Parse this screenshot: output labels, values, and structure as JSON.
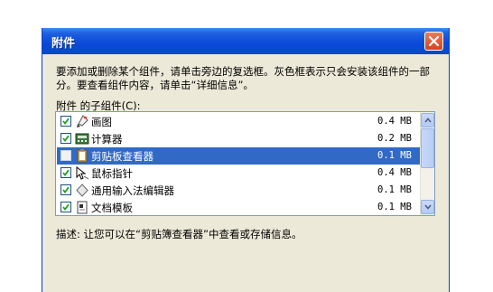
{
  "window": {
    "title": "附件",
    "close_icon": "close-x-icon"
  },
  "description": "要添加或删除某个组件，请单击旁边的复选框。灰色框表示只会安装该组件的一部分。要查看组件内容，请单击“详细信息”。",
  "list": {
    "label": "附件 的子组件(C):",
    "items": [
      {
        "name": "画图",
        "size": "0.4 MB",
        "checked": true,
        "icon": "paint-icon",
        "selected": false
      },
      {
        "name": "计算器",
        "size": "0.2 MB",
        "checked": true,
        "icon": "calculator-icon",
        "selected": false
      },
      {
        "name": "剪贴板查看器",
        "size": "0.1 MB",
        "checked": false,
        "icon": "clipboard-icon",
        "selected": true
      },
      {
        "name": "鼠标指针",
        "size": "0.4 MB",
        "checked": true,
        "icon": "mouse-pointer-icon",
        "selected": false
      },
      {
        "name": "通用输入法编辑器",
        "size": "0.1 MB",
        "checked": true,
        "icon": "ime-diamond-icon",
        "selected": false
      },
      {
        "name": "文档模板",
        "size": "0.1 MB",
        "checked": true,
        "icon": "document-template-icon",
        "selected": false
      }
    ]
  },
  "footer": {
    "description": "描述:  让您可以在“剪贴簿查看器”中查看或存储信息。"
  },
  "colors": {
    "title_bar": "#0a49d8",
    "selection": "#316ac5",
    "dialog_bg": "#ece9d8"
  }
}
